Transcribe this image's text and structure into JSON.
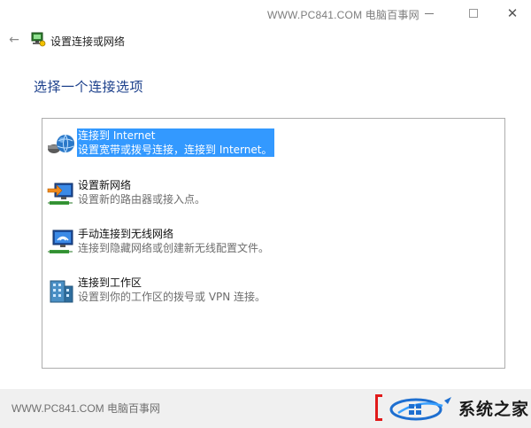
{
  "titlebar": {
    "watermark": "WWW.PC841.COM 电脑百事网"
  },
  "header": {
    "wizard_title": "设置连接或网络",
    "heading": "选择一个连接选项"
  },
  "options": [
    {
      "title": "连接到 Internet",
      "description": "设置宽带或拨号连接，连接到 Internet。",
      "icon": "globe-network-icon",
      "selected": true
    },
    {
      "title": "设置新网络",
      "description": "设置新的路由器或接入点。",
      "icon": "new-network-icon",
      "selected": false
    },
    {
      "title": "手动连接到无线网络",
      "description": "连接到隐藏网络或创建新无线配置文件。",
      "icon": "wireless-network-icon",
      "selected": false
    },
    {
      "title": "连接到工作区",
      "description": "设置到你的工作区的拨号或 VPN 连接。",
      "icon": "workplace-icon",
      "selected": false
    }
  ],
  "footer": {
    "watermark": "WWW.PC841.COM 电脑百事网",
    "brand_text": "系统之家"
  },
  "colors": {
    "selection": "#3399ff",
    "heading": "#1b3f8b",
    "brand_red": "#e11a1a",
    "brand_blue": "#1e6fd0"
  }
}
